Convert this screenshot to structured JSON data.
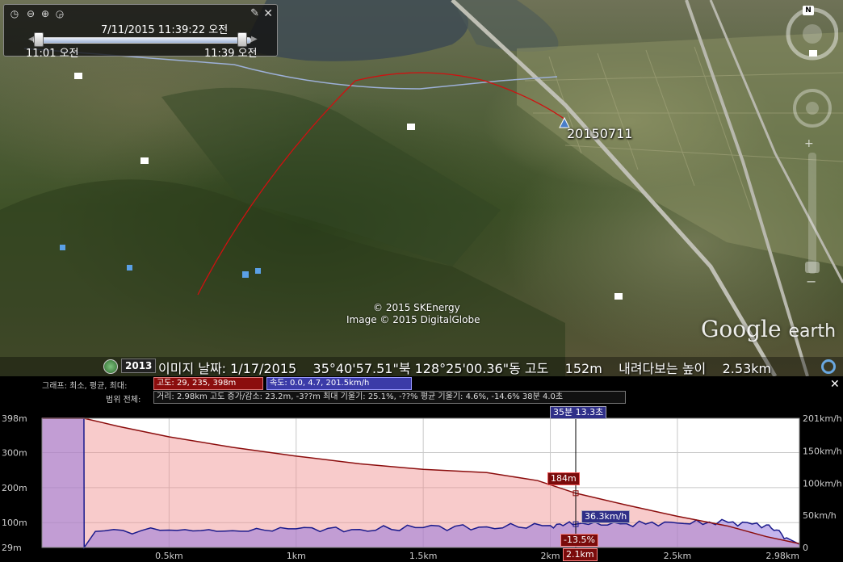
{
  "timeline": {
    "current": "7/11/2015  11:39:22 오전",
    "start": "11:01 오전",
    "end": "11:39 오전"
  },
  "map": {
    "track_label": "20150711",
    "copyright1": "© 2015 SKEnergy",
    "copyright2": "Image © 2015 DigitalGlobe",
    "brand": "Google",
    "brand_suffix": "earth",
    "north": "N"
  },
  "status": {
    "year": "2013",
    "text": "이미지 날짜: 1/17/2015    35°40'57.51\"북 128°25'00.36\"동 고도    152m    내려다보는 높이    2.53km"
  },
  "profile": {
    "row1_label": "그래프: 최소, 평균, 최대:",
    "elev_box": "고도: 29, 235, 398m",
    "speed_box": "속도: 0.0, 4.7, 201.5km/h",
    "row2_label": "범위 전체:",
    "stats_box": "거리: 2.98km 고도 증가/감소: 23.2m, -3??m 최대 기울기: 25.1%, -??% 평균 기울기: 4.6%, -14.6% 38분 4.0초",
    "time_tag": "35분 13.3초",
    "elev_tag": "184m",
    "speed_tag": "36.3km/h",
    "slope_tag": "-13.5%",
    "dist_tag": "2.1km",
    "colors": {
      "elevation": "#8b0d0d",
      "speed": "#1a1a8c"
    }
  },
  "chart_data": {
    "type": "area",
    "xlabel": "",
    "ylabel": "",
    "x_ticks": [
      "0.5km",
      "1km",
      "1.5km",
      "2km",
      "2.5km",
      "2.98km"
    ],
    "y_left_ticks": [
      "398m",
      "300m",
      "200m",
      "100m",
      "29m"
    ],
    "y_right_ticks": [
      "201km/h",
      "150km/h",
      "100km/h",
      "50km/h",
      "0"
    ],
    "xlim": [
      0,
      2.98
    ],
    "ylim_left": [
      29,
      398
    ],
    "ylim_right": [
      0,
      201
    ],
    "grid": true,
    "cursor_x": 2.1,
    "series": [
      {
        "name": "고도",
        "axis": "left",
        "x": [
          0,
          0.165,
          0.3,
          0.5,
          0.75,
          1.0,
          1.25,
          1.5,
          1.75,
          1.95,
          2.1,
          2.3,
          2.5,
          2.7,
          2.85,
          2.98
        ],
        "y": [
          398,
          398,
          375,
          345,
          315,
          290,
          268,
          252,
          243,
          220,
          184,
          150,
          118,
          90,
          60,
          40
        ]
      },
      {
        "name": "속도",
        "axis": "right",
        "x": [
          0,
          0.165,
          0.166,
          0.21,
          0.5,
          0.75,
          1.0,
          1.25,
          1.5,
          1.75,
          2.0,
          2.1,
          2.3,
          2.5,
          2.7,
          2.85,
          2.93,
          2.98
        ],
        "y": [
          201,
          201,
          0,
          25,
          27,
          26,
          29,
          28,
          31,
          32,
          34,
          36.3,
          37,
          38,
          39,
          35,
          15,
          5
        ]
      }
    ]
  }
}
